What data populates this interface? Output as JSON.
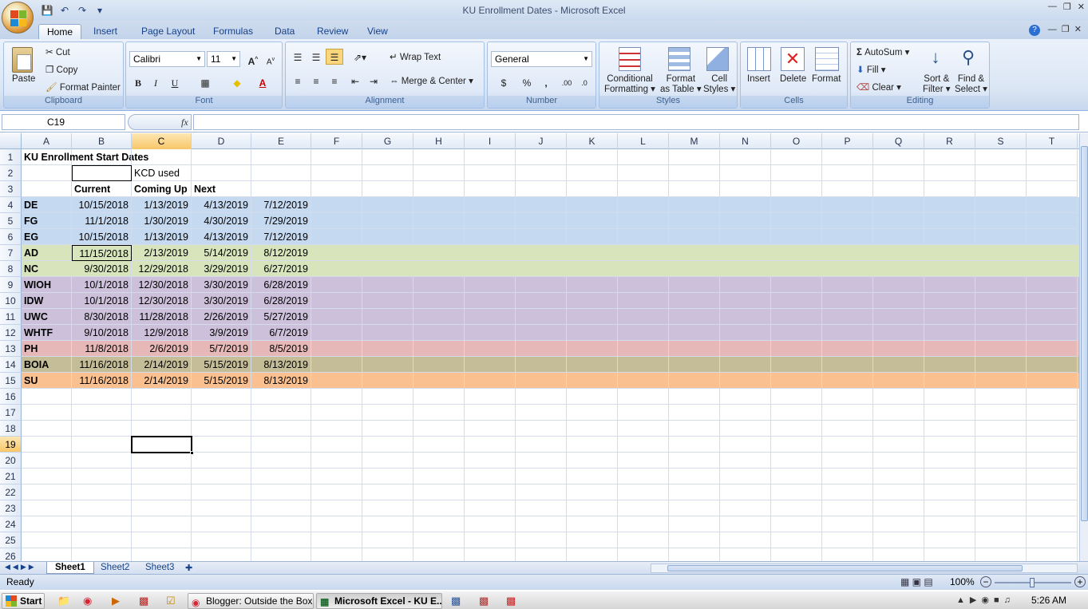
{
  "window": {
    "title": "KU Enrollment Dates - Microsoft Excel"
  },
  "tabs": [
    "Home",
    "Insert",
    "Page Layout",
    "Formulas",
    "Data",
    "Review",
    "View"
  ],
  "ribbon": {
    "clipboard": {
      "label": "Clipboard",
      "paste": "Paste",
      "cut": "Cut",
      "copy": "Copy",
      "format_painter": "Format Painter"
    },
    "font": {
      "label": "Font",
      "name": "Calibri",
      "size": "11",
      "bold": "B",
      "italic": "I",
      "underline": "U"
    },
    "alignment": {
      "label": "Alignment",
      "wrap_text": "Wrap Text",
      "merge_center": "Merge & Center"
    },
    "number": {
      "label": "Number",
      "format": "General",
      "currency": "$",
      "percent": "%",
      "comma": ","
    },
    "styles": {
      "label": "Styles",
      "conditional_1": "Conditional",
      "conditional_2": "Formatting",
      "format_table_1": "Format",
      "format_table_2": "as Table",
      "cell_styles_1": "Cell",
      "cell_styles_2": "Styles"
    },
    "cells": {
      "label": "Cells",
      "insert": "Insert",
      "delete": "Delete",
      "format": "Format"
    },
    "editing": {
      "label": "Editing",
      "autosum": "AutoSum",
      "fill": "Fill",
      "clear": "Clear",
      "sort_1": "Sort &",
      "sort_2": "Filter",
      "find_1": "Find &",
      "find_2": "Select"
    }
  },
  "formula_bar": {
    "name_box": "C19",
    "fx": "fx",
    "formula": ""
  },
  "columns": [
    "A",
    "B",
    "C",
    "D",
    "E",
    "F",
    "G",
    "H",
    "I",
    "J",
    "K",
    "L",
    "M",
    "N",
    "O",
    "P",
    "Q",
    "R",
    "S",
    "T"
  ],
  "selected_column": "C",
  "selected_row": "19",
  "rows": [
    {
      "n": "1",
      "cells": {
        "A": "KU Enrollment Start Dates"
      }
    },
    {
      "n": "2",
      "cells": {
        "C": "KCD used"
      }
    },
    {
      "n": "3",
      "cells": {
        "B": "Current",
        "C": "Coming Up",
        "D": "Next"
      }
    },
    {
      "n": "4",
      "fill": "#c5d9f1",
      "cells": {
        "A": "DE",
        "B": "10/15/2018",
        "C": "1/13/2019",
        "D": "4/13/2019",
        "E": "7/12/2019"
      }
    },
    {
      "n": "5",
      "fill": "#c5d9f1",
      "cells": {
        "A": "FG",
        "B": "11/1/2018",
        "C": "1/30/2019",
        "D": "4/30/2019",
        "E": "7/29/2019"
      }
    },
    {
      "n": "6",
      "fill": "#c5d9f1",
      "cells": {
        "A": "EG",
        "B": "10/15/2018",
        "C": "1/13/2019",
        "D": "4/13/2019",
        "E": "7/12/2019"
      }
    },
    {
      "n": "7",
      "fill": "#d8e4bc",
      "cells": {
        "A": "AD",
        "B": "11/15/2018",
        "C": "2/13/2019",
        "D": "5/14/2019",
        "E": "8/12/2019"
      }
    },
    {
      "n": "8",
      "fill": "#d8e4bc",
      "cells": {
        "A": "NC",
        "B": "9/30/2018",
        "C": "12/29/2018",
        "D": "3/29/2019",
        "E": "6/27/2019"
      }
    },
    {
      "n": "9",
      "fill": "#ccc0da",
      "cells": {
        "A": "WIOH",
        "B": "10/1/2018",
        "C": "12/30/2018",
        "D": "3/30/2019",
        "E": "6/28/2019"
      }
    },
    {
      "n": "10",
      "fill": "#ccc0da",
      "cells": {
        "A": "IDW",
        "B": "10/1/2018",
        "C": "12/30/2018",
        "D": "3/30/2019",
        "E": "6/28/2019"
      }
    },
    {
      "n": "11",
      "fill": "#ccc0da",
      "cells": {
        "A": "UWC",
        "B": "8/30/2018",
        "C": "11/28/2018",
        "D": "2/26/2019",
        "E": "5/27/2019"
      }
    },
    {
      "n": "12",
      "fill": "#ccc0da",
      "cells": {
        "A": "WHTF",
        "B": "9/10/2018",
        "C": "12/9/2018",
        "D": "3/9/2019",
        "E": "6/7/2019"
      }
    },
    {
      "n": "13",
      "fill": "#e6b9b8",
      "cells": {
        "A": "PH",
        "B": "11/8/2018",
        "C": "2/6/2019",
        "D": "5/7/2019",
        "E": "8/5/2019"
      }
    },
    {
      "n": "14",
      "fill": "#c4bd97",
      "cells": {
        "A": "BOIA",
        "B": "11/16/2018",
        "C": "2/14/2019",
        "D": "5/15/2019",
        "E": "8/13/2019"
      }
    },
    {
      "n": "15",
      "fill": "#fac090",
      "cells": {
        "A": "SU",
        "B": "11/16/2018",
        "C": "2/14/2019",
        "D": "5/15/2019",
        "E": "8/13/2019"
      }
    },
    {
      "n": "16",
      "cells": {}
    },
    {
      "n": "17",
      "cells": {}
    },
    {
      "n": "18",
      "cells": {}
    },
    {
      "n": "19",
      "cells": {}
    },
    {
      "n": "20",
      "cells": {}
    },
    {
      "n": "21",
      "cells": {}
    },
    {
      "n": "22",
      "cells": {}
    },
    {
      "n": "23",
      "cells": {}
    },
    {
      "n": "24",
      "cells": {}
    },
    {
      "n": "25",
      "cells": {}
    },
    {
      "n": "26",
      "cells": {}
    }
  ],
  "sheets": [
    "Sheet1",
    "Sheet2",
    "Sheet3"
  ],
  "active_sheet": "Sheet1",
  "status": {
    "text": "Ready",
    "zoom": "100%"
  },
  "taskbar": {
    "start": "Start",
    "items": [
      "Blogger: Outside the Box...",
      "Microsoft Excel - KU E..."
    ],
    "clock": "5:26 AM"
  }
}
